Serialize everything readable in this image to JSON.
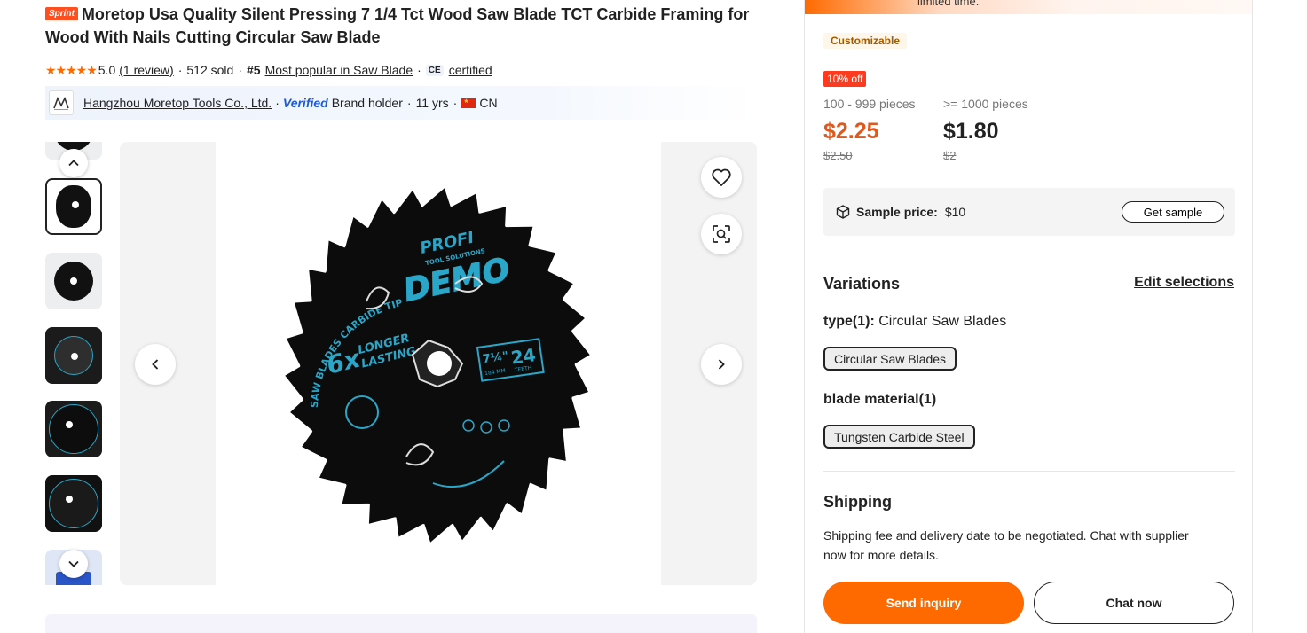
{
  "product": {
    "sprint_badge": "Sprint",
    "title": "Moretop Usa Quality Silent Pressing 7 1/4 Tct Wood Saw Blade TCT Carbide Framing for Wood With Nails Cutting Circular Saw Blade"
  },
  "rating": {
    "stars": "★★★★★",
    "score": "5.0",
    "reviews_link": "(1 review)",
    "sold": "512 sold",
    "rank": "#5",
    "rank_link": "Most popular in Saw Blade",
    "cert_mark": "CE",
    "certified_link": "certified"
  },
  "supplier": {
    "name": "Hangzhou Moretop Tools Co., Ltd.",
    "verified": "Verified",
    "role": "Brand holder",
    "years": "11 yrs",
    "country": "CN"
  },
  "gallery": {
    "image_print": {
      "brand": "PROFI",
      "brand_sub": "TOOL SOLUTIONS",
      "model": "DEMO",
      "multiplier": "6x",
      "longer": "LONGER",
      "lasting": "LASTING",
      "size": "7¼\"",
      "size_mm": "184 MM",
      "teeth": "24",
      "teeth_label": "TEETH",
      "ring_text": "SAW BLADES CARBIDE TIPPED"
    }
  },
  "panel": {
    "promo_text": "limited time.",
    "customizable": "Customizable",
    "discount": "10% off",
    "tiers": [
      {
        "range": "100 - 999 pieces",
        "price": "$2.25",
        "old_price": "$2.50"
      },
      {
        "range": ">= 1000 pieces",
        "price": "$1.80",
        "old_price": "$2"
      }
    ],
    "sample_label": "Sample price:",
    "sample_value": "$10",
    "get_sample": "Get sample",
    "variations_title": "Variations",
    "edit_selections": "Edit selections",
    "type_label": "type(1):",
    "type_value": "Circular Saw Blades",
    "type_option": "Circular Saw Blades",
    "material_label": "blade material(1)",
    "material_option": "Tungsten Carbide Steel",
    "shipping_title": "Shipping",
    "shipping_text": "Shipping fee and delivery date to be negotiated. Chat with supplier now for more details.",
    "send_inquiry": "Send inquiry",
    "chat_now": "Chat now"
  },
  "colors": {
    "accent_orange": "#ff6a00",
    "price_orange": "#e2571c",
    "discount_red": "#ff3b1f",
    "verified_blue": "#1e5bd8",
    "blade_teal": "#2aa6c8"
  }
}
